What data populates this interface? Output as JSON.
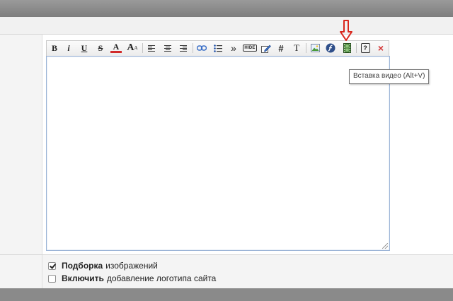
{
  "toolbar": {
    "bold_label": "B",
    "italic_label": "i",
    "underline_label": "U",
    "strike_label": "S",
    "color_label": "A",
    "size_label": "A",
    "quote_label": "»",
    "hide_label": "HIDE",
    "hash_label": "#",
    "text_label": "T",
    "help_label": "?",
    "remove_label": "×"
  },
  "icons": {
    "bold": "bold-icon",
    "italic": "italic-icon",
    "underline": "underline-icon",
    "strike": "strikethrough-icon",
    "color": "font-color-icon",
    "size": "font-size-icon",
    "align_left": "align-left-icon",
    "align_center": "align-center-icon",
    "align_right": "align-right-icon",
    "link": "link-icon",
    "list": "bullet-list-icon",
    "quote": "quote-icon",
    "hide": "hide-icon",
    "edit": "edit-icon",
    "hash": "hash-icon",
    "text": "text-icon",
    "image": "image-icon",
    "flash": "flash-icon",
    "video": "video-icon",
    "help": "help-icon",
    "remove_format": "remove-format-icon"
  },
  "tooltip": {
    "text": "Вставка видео (Alt+V)"
  },
  "editor": {
    "value": ""
  },
  "options": [
    {
      "bold": "Подборка",
      "rest": "изображений",
      "checked": true
    },
    {
      "bold": "Включить",
      "rest": "добавление логотипа сайта",
      "checked": false
    }
  ],
  "colors": {
    "arrow": "#d9261c",
    "remove_icon": "#d33333",
    "editor_border": "#9ab3d6",
    "font_color_underline": "#d12a2a"
  }
}
